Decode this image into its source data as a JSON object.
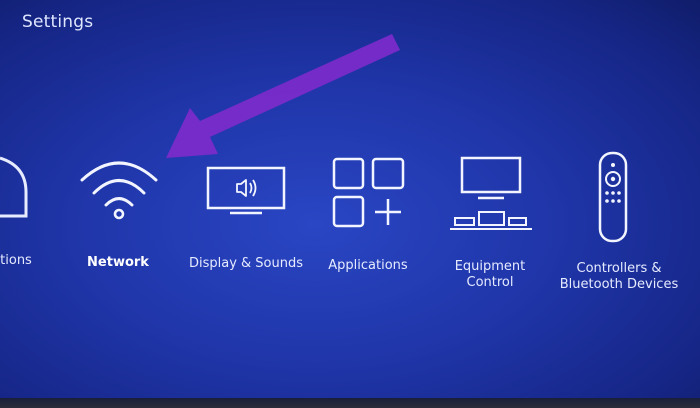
{
  "header": {
    "title": "Settings"
  },
  "menu": {
    "items": [
      {
        "label": "tions",
        "icon": "partial-arch-icon"
      },
      {
        "label": "Network",
        "icon": "wifi-icon",
        "selected": true
      },
      {
        "label": "Display & Sounds",
        "icon": "display-sound-icon"
      },
      {
        "label": "Applications",
        "icon": "applications-grid-icon"
      },
      {
        "label": "Equipment\nControl",
        "icon": "equipment-control-icon"
      },
      {
        "label": "Controllers &\nBluetooth Devices",
        "icon": "remote-control-icon"
      }
    ]
  },
  "colors": {
    "background": "#1f35a8",
    "arrow": "#7a2bc9",
    "text": "#e6ebff"
  }
}
